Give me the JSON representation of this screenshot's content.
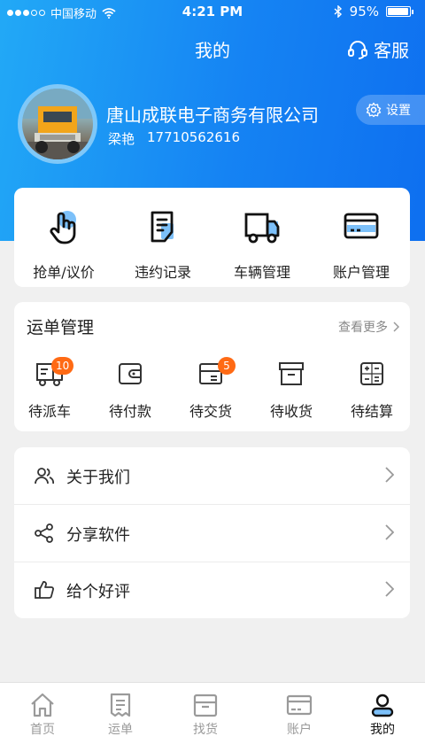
{
  "status_bar": {
    "carrier": "中国移动",
    "time": "4:21 PM",
    "battery": "95%",
    "battery_level": 0.95
  },
  "header": {
    "title": "我的",
    "service_label": "客服"
  },
  "profile": {
    "company": "唐山成联电子商务有限公司",
    "name": "梁艳",
    "phone": "17710562616",
    "settings_label": "设置"
  },
  "quick_actions": [
    {
      "label": "抢单/议价",
      "icon": "tap-hand-icon"
    },
    {
      "label": "违约记录",
      "icon": "document-icon"
    },
    {
      "label": "车辆管理",
      "icon": "truck-icon"
    },
    {
      "label": "账户管理",
      "icon": "card-icon"
    }
  ],
  "orders": {
    "title": "运单管理",
    "more_label": "查看更多",
    "items": [
      {
        "label": "待派车",
        "icon": "truck-icon",
        "badge": "10"
      },
      {
        "label": "待付款",
        "icon": "wallet-icon",
        "badge": ""
      },
      {
        "label": "待交货",
        "icon": "tray-icon",
        "badge": "5"
      },
      {
        "label": "待收货",
        "icon": "archive-box-icon",
        "badge": ""
      },
      {
        "label": "待结算",
        "icon": "calculator-icon",
        "badge": ""
      }
    ]
  },
  "menu": [
    {
      "label": "关于我们",
      "icon": "users-icon"
    },
    {
      "label": "分享软件",
      "icon": "share-icon"
    },
    {
      "label": "给个好评",
      "icon": "thumbs-up-icon"
    }
  ],
  "tabbar": [
    {
      "label": "首页",
      "icon": "home-icon",
      "active": false
    },
    {
      "label": "运单",
      "icon": "receipt-icon",
      "active": false
    },
    {
      "label": "找货",
      "icon": "box-icon",
      "active": false
    },
    {
      "label": "账户",
      "icon": "wallet-card-icon",
      "active": false
    },
    {
      "label": "我的",
      "icon": "person-icon",
      "active": true
    }
  ],
  "colors": {
    "brand_blue": "#1583f3",
    "badge_orange": "#ff6a14",
    "icon_accent": "#7cc0f9"
  }
}
